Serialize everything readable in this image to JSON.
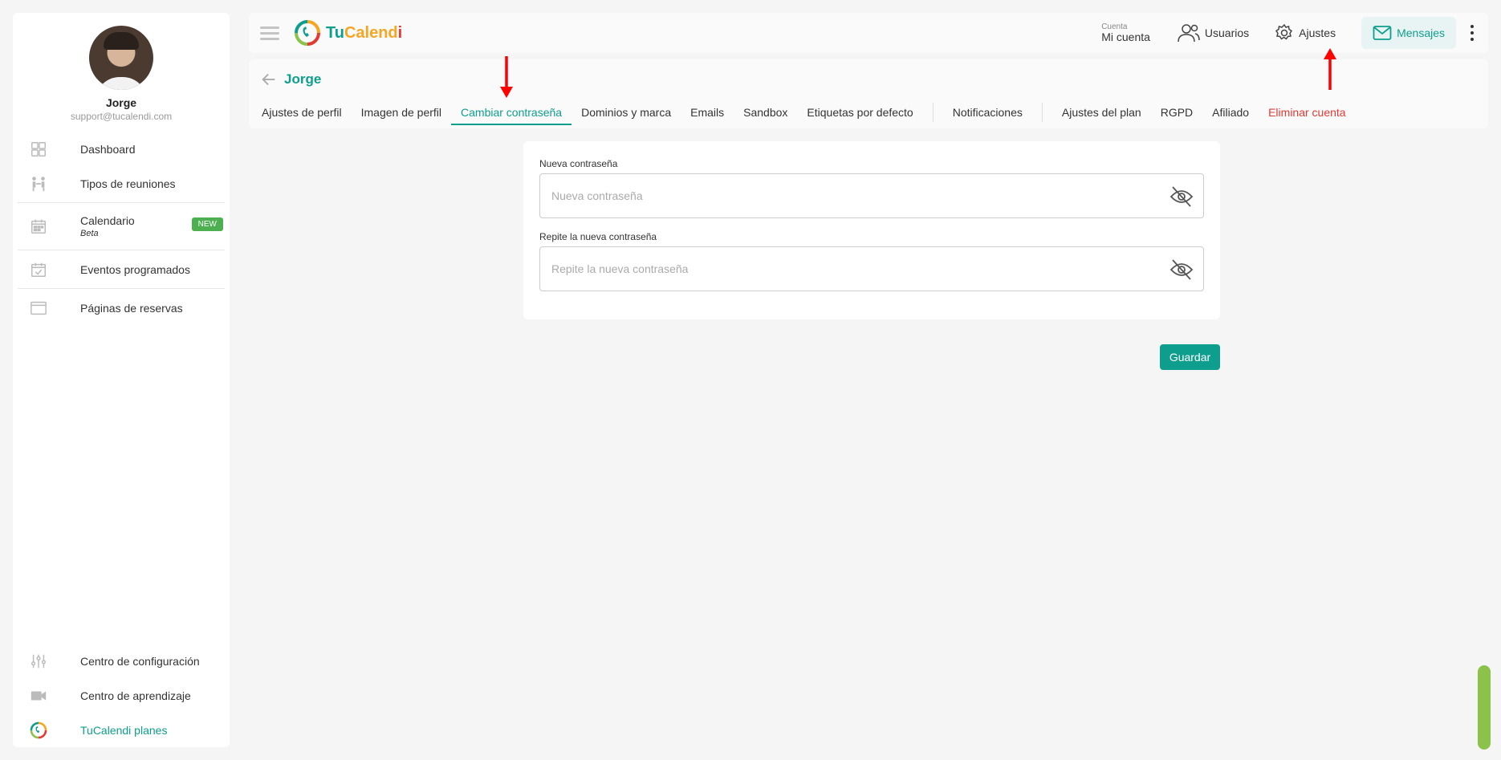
{
  "profile": {
    "name": "Jorge",
    "email": "support@tucalendi.com"
  },
  "sidebar": {
    "items": [
      {
        "label": "Dashboard",
        "icon": "dashboard-icon"
      },
      {
        "label": "Tipos de reuniones",
        "icon": "meeting-types-icon"
      },
      {
        "label": "Calendario",
        "sub": "Beta",
        "badge": "NEW",
        "icon": "calendar-icon"
      },
      {
        "label": "Eventos programados",
        "icon": "scheduled-events-icon"
      },
      {
        "label": "Páginas de reservas",
        "icon": "booking-pages-icon"
      }
    ],
    "bottom": [
      {
        "label": "Centro de configuración",
        "icon": "settings-sliders-icon"
      },
      {
        "label": "Centro de aprendizaje",
        "icon": "video-icon"
      },
      {
        "label": "TuCalendi planes",
        "icon": "tucalendi-logo-icon"
      }
    ]
  },
  "topbar": {
    "logo": {
      "tu": "Tu",
      "cal": "Calend",
      "i": "i"
    },
    "account_label": "Cuenta",
    "account_value": "Mi cuenta",
    "users": "Usuarios",
    "settings": "Ajustes",
    "messages": "Mensajes"
  },
  "subheader": {
    "title": "Jorge",
    "tabs": [
      "Ajustes de perfil",
      "Imagen de perfil",
      "Cambiar contraseña",
      "Dominios y marca",
      "Emails",
      "Sandbox",
      "Etiquetas por defecto",
      "Notificaciones",
      "Ajustes del plan",
      "RGPD",
      "Afiliado",
      "Eliminar cuenta"
    ],
    "active_tab": "Cambiar contraseña"
  },
  "form": {
    "new_password_label": "Nueva contraseña",
    "new_password_placeholder": "Nueva contraseña",
    "new_password_value": "",
    "repeat_password_label": "Repite la nueva contraseña",
    "repeat_password_placeholder": "Repite la nueva contraseña",
    "repeat_password_value": "",
    "save_label": "Guardar"
  },
  "colors": {
    "brand": "#0e9e8e",
    "danger": "#e53935",
    "badge": "#4caf50",
    "annotation": "#ff0000"
  }
}
